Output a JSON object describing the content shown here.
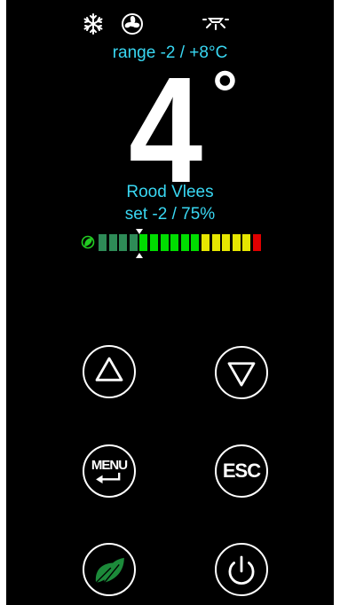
{
  "status_icons": [
    "snowflake-icon",
    "fan-icon",
    "light-icon"
  ],
  "range_text": "range -2 / +8°C",
  "temperature": {
    "value": "4",
    "unit": "°"
  },
  "profile_name": "Rood Vlees",
  "setpoint_text": "set -2 / 75%",
  "level_meter": {
    "segments": [
      "#2e8b57",
      "#2e8b57",
      "#2e8b57",
      "#2e8b57",
      "#00dd00",
      "#00dd00",
      "#00dd00",
      "#00dd00",
      "#00dd00",
      "#00dd00",
      "#e6e600",
      "#e6e600",
      "#e6e600",
      "#e6e600",
      "#e6e600",
      "#e00000"
    ],
    "marker_index": 4,
    "eco_icon_color": "#22cc22"
  },
  "buttons": {
    "up": "up-arrow-icon",
    "down": "down-arrow-icon",
    "menu_label": "MENU",
    "esc_label": "ESC",
    "eco": "leaf-icon",
    "power": "power-icon"
  },
  "colors": {
    "text_accent": "#39d7f2",
    "background": "#000000",
    "eco_green": "#1c8a3a"
  }
}
